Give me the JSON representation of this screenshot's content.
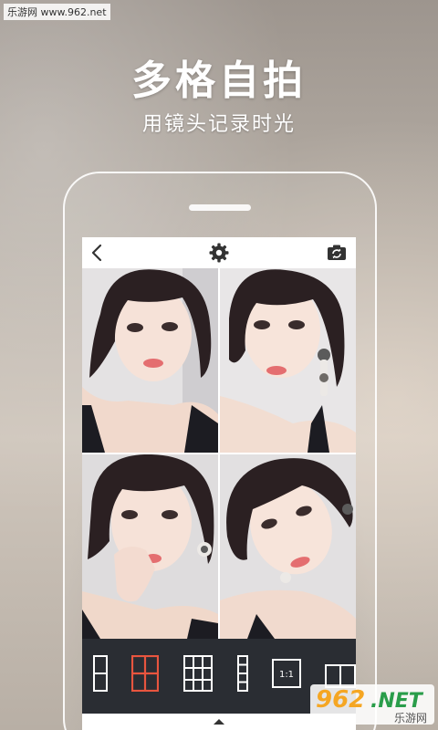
{
  "watermark_top": "乐游网 www.962.net",
  "headline": "多格自拍",
  "subline": "用镜头记录时光",
  "topbar": {
    "icons": [
      "back-icon",
      "gear-icon",
      "camera-switch-icon"
    ]
  },
  "layout_options": [
    {
      "name": "layout-1x2-icon",
      "selected": false
    },
    {
      "name": "layout-2x2-icon",
      "selected": true
    },
    {
      "name": "layout-3x3-icon",
      "selected": false
    },
    {
      "name": "layout-1x4-icon",
      "selected": false
    },
    {
      "name": "ratio-1-1-icon",
      "label": "1:1",
      "selected": false
    },
    {
      "name": "layout-2x1-icon",
      "selected": false
    }
  ],
  "colors": {
    "accent": "#e8553f",
    "bottombar": "#2a2d33",
    "icon": "#ffffff"
  },
  "watermark_bottom": {
    "logo_digits": "962",
    "logo_suffix": ".NET",
    "site": "乐游网"
  }
}
